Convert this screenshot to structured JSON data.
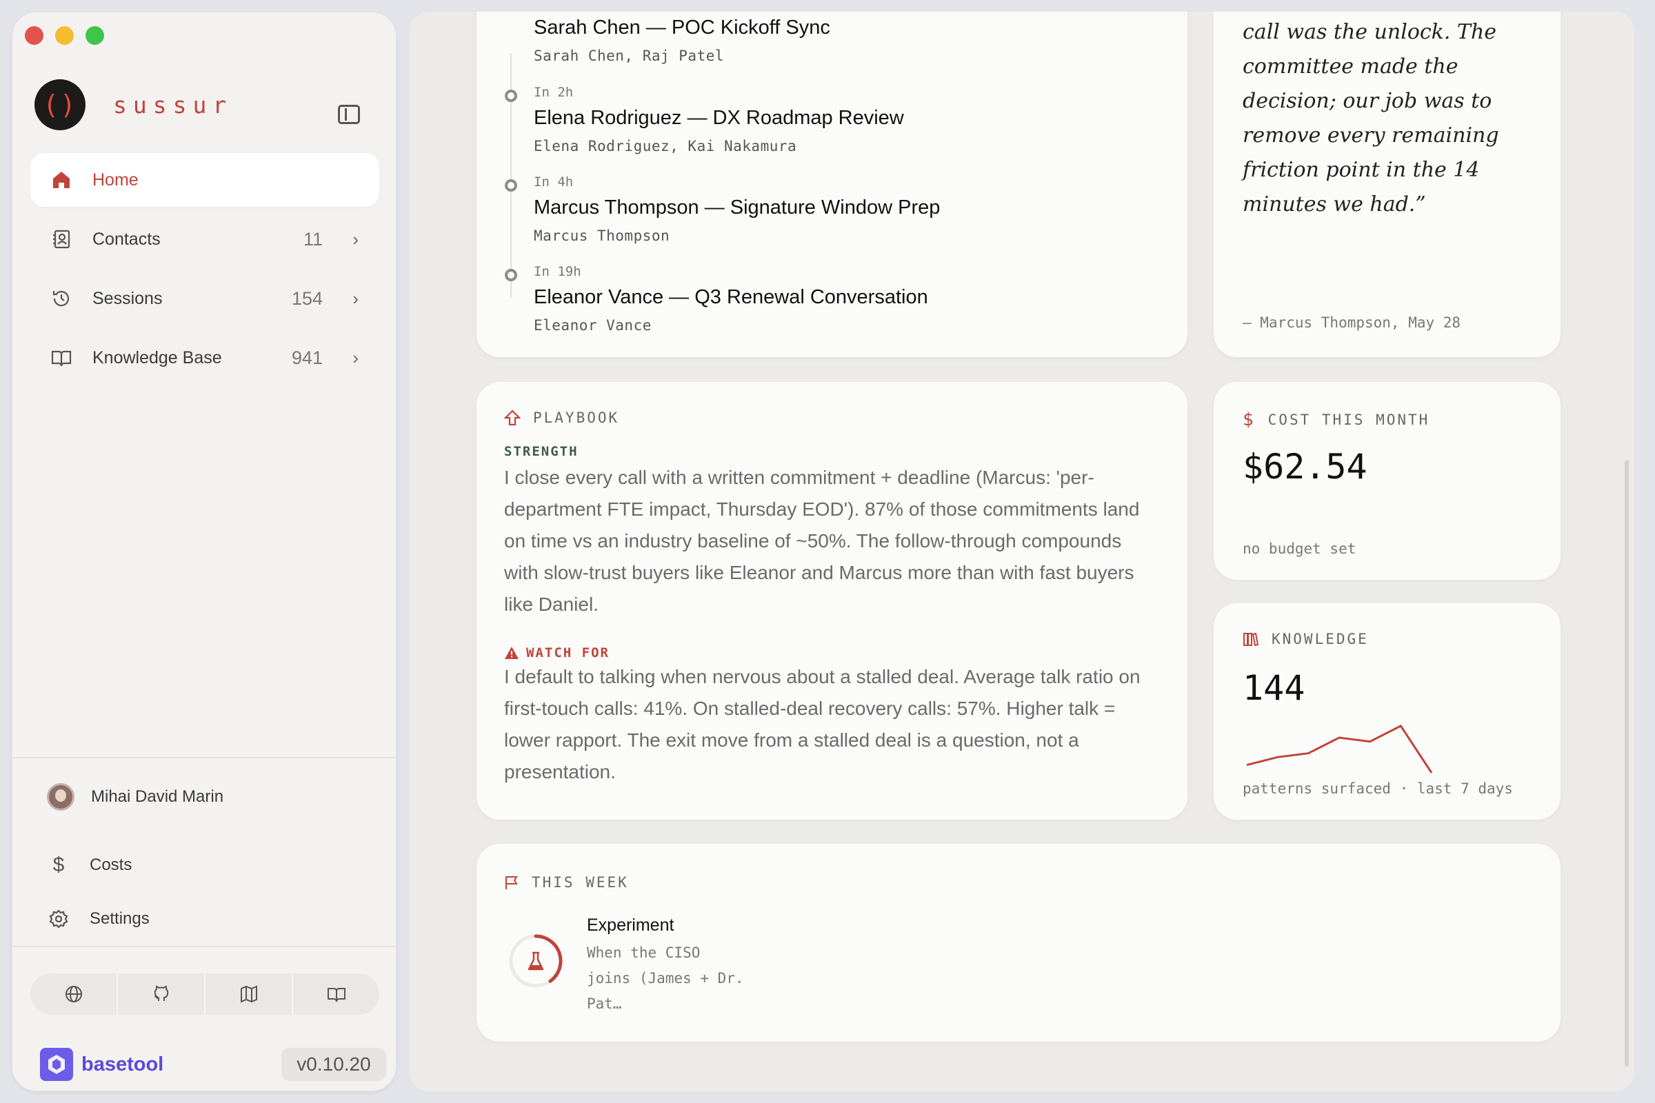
{
  "brand": {
    "name": "sussur",
    "logo_glyph": "()"
  },
  "nav": [
    {
      "label": "Home",
      "icon": "home-icon",
      "active": true
    },
    {
      "label": "Contacts",
      "icon": "contacts-icon",
      "count": "11"
    },
    {
      "label": "Sessions",
      "icon": "history-icon",
      "count": "154"
    },
    {
      "label": "Knowledge Base",
      "icon": "book-icon",
      "count": "941"
    }
  ],
  "user": {
    "name": "Mihai David Marin"
  },
  "footer_nav": {
    "costs": "Costs",
    "settings": "Settings"
  },
  "link_bar": [
    "globe-icon",
    "github-icon",
    "map-icon",
    "book-open-icon"
  ],
  "basetool": {
    "name": "basetool",
    "version": "v0.10.20"
  },
  "schedule": {
    "events": [
      {
        "when": "",
        "title": "Sarah Chen — POC Kickoff Sync",
        "people": "Sarah Chen, Raj Patel"
      },
      {
        "when": "In 2h",
        "title": "Elena Rodriguez — DX Roadmap Review",
        "people": "Elena Rodriguez, Kai Nakamura"
      },
      {
        "when": "In 4h",
        "title": "Marcus Thompson — Signature Window Prep",
        "people": "Marcus Thompson"
      },
      {
        "when": "In 19h",
        "title": "Eleanor Vance — Q3 Renewal Conversation",
        "people": "Eleanor Vance"
      }
    ]
  },
  "quote": {
    "text": "call was the unlock. The committee made the decision; our job was to remove every remaining friction point in the 14 minutes we had.”",
    "attribution": "— Marcus Thompson, May 28"
  },
  "playbook": {
    "label": "PLAYBOOK",
    "strength_label": "STRENGTH",
    "strength_text": "I close every call with a written commitment + deadline (Marcus: 'per-department FTE impact, Thursday EOD'). 87% of those commitments land on time vs an industry baseline of ~50%. The follow-through compounds with slow-trust buyers like Eleanor and Marcus more than with fast buyers like Daniel.",
    "watch_label": "WATCH FOR",
    "watch_text": "I default to talking when nervous about a stalled deal. Average talk ratio on first-touch calls: 41%. On stalled-deal recovery calls: 57%. Higher talk = lower rapport. The exit move from a stalled deal is a question, not a presentation."
  },
  "cost": {
    "label": "COST THIS MONTH",
    "value": "$62.54",
    "note": "no budget set"
  },
  "knowledge": {
    "label": "KNOWLEDGE",
    "value": "144",
    "caption": "patterns surfaced · last 7 days",
    "sparkline": [
      2,
      4,
      5,
      9,
      8,
      12,
      0
    ]
  },
  "this_week": {
    "label": "THIS WEEK",
    "experiment_title": "Experiment",
    "experiment_desc": "When the CISO joins (James + Dr. Pat…",
    "progress": 0.4
  },
  "colors": {
    "accent": "#c0443a",
    "green_label": "#3f5a48"
  }
}
